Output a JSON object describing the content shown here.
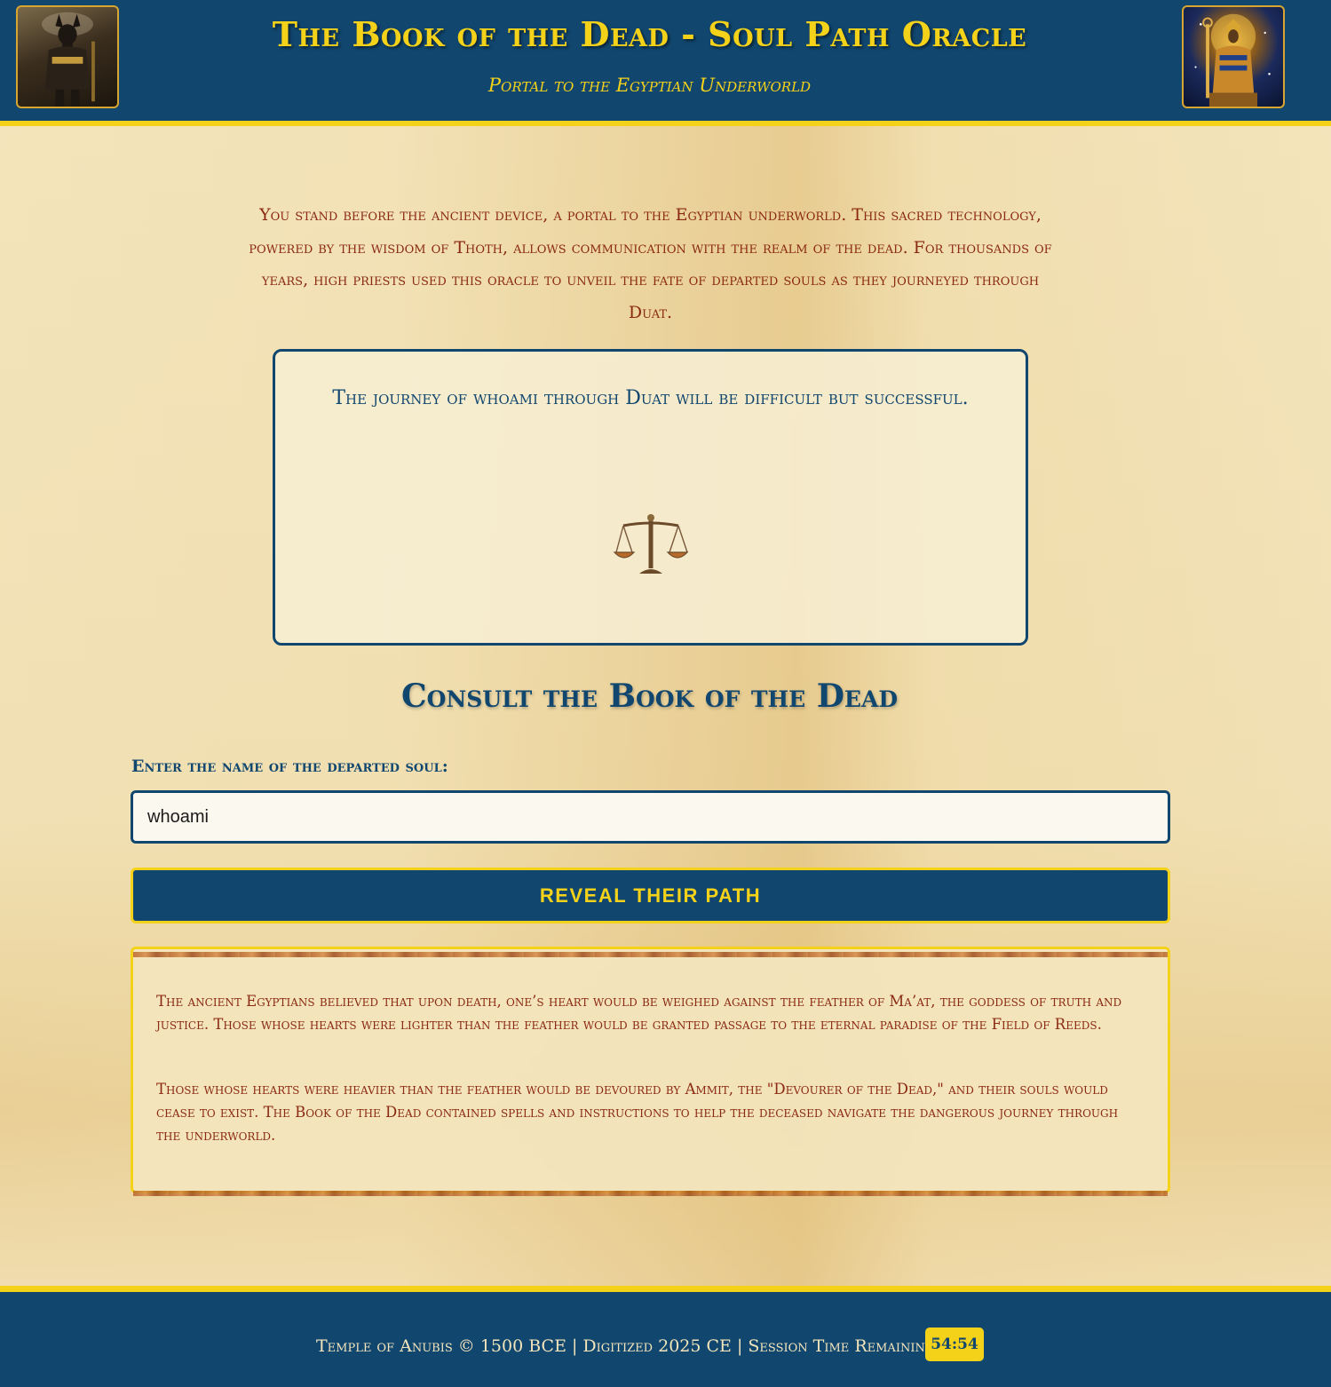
{
  "header": {
    "title": "The Book of the Dead - Soul Path Oracle",
    "subtitle": "Portal to the Egyptian Underworld",
    "left_image_icon": "anubis-statue-icon",
    "right_image_icon": "pharaoh-god-icon"
  },
  "intro": {
    "text": "You stand before the ancient device, a portal to the Egyptian underworld. This sacred technology, powered by the wisdom of Thoth, allows communication with the realm of the dead. For thousands of years, high priests used this oracle to unveil the fate of departed souls as they journeyed through Duat."
  },
  "oracle": {
    "result_text": "The journey of whoami through Duat will be difficult but successful.",
    "icon": "scales-icon"
  },
  "consult": {
    "title": "Consult the Book of the Dead",
    "field_label": "Enter the name of the departed soul:",
    "input_value": "whoami",
    "button_label": "Reveal Their Path"
  },
  "info": {
    "paragraph_1": "The ancient Egyptians believed that upon death, one’s heart would be weighed against the feather of Ma’at, the goddess of truth and justice. Those whose hearts were lighter than the feather would be granted passage to the eternal paradise of the Field of Reeds.",
    "paragraph_2": "Those whose hearts were heavier than the feather would be devoured by Ammit, the \"Devourer of the Dead,\" and their souls would cease to exist. The Book of the Dead contained spells and instructions to help the deceased navigate the dangerous journey through the underworld."
  },
  "footer": {
    "text": "Temple of Anubis © 1500 BCE | Digitized 2025 CE | Session Time Remaining:",
    "timer": "54:54"
  },
  "colors": {
    "primary_blue": "#11476f",
    "gold": "#f5d21a",
    "text_red": "#8b2a12",
    "parchment": "#f3e3b7"
  }
}
